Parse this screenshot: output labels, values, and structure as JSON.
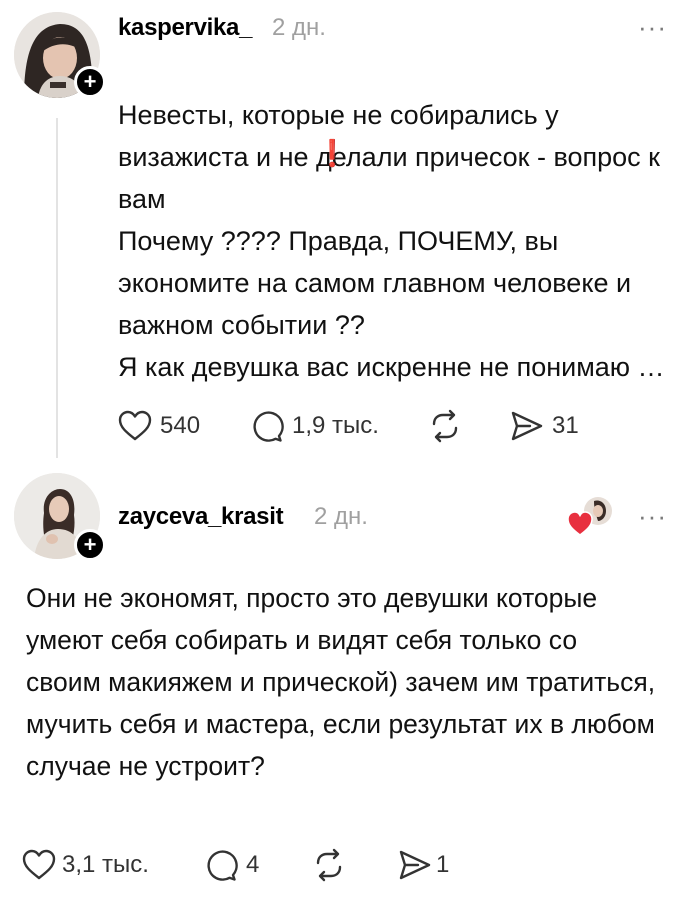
{
  "posts": [
    {
      "username": "kaspervika_",
      "time": "2 дн.",
      "text": "Невесты, которые не собирались у визажиста и не делали причесок - вопрос к вам\nПочему ???? Правда, ПОЧЕМУ, вы экономите на самом главном человеке и важном событии ??\nЯ как девушка вас искренне не понимаю …",
      "exclamation": "❗",
      "likes": "540",
      "replies": "1,9 тыс.",
      "reposts": "",
      "shares": "31"
    },
    {
      "username": "zayceva_krasit",
      "time": "2 дн.",
      "text": "Они не экономят, просто это девушки которые умеют себя собирать и видят себя только со своим макияжем и прической) зачем им тратиться, мучить себя и мастера, если результат их в любом случае не устроит?",
      "likes": "3,1 тыс.",
      "replies": "4",
      "reposts": "",
      "shares": "1"
    }
  ],
  "more_label": "···",
  "plus_label": "+",
  "colors": {
    "heart_liked": "#e8303f",
    "muted": "#a0a0a0"
  }
}
